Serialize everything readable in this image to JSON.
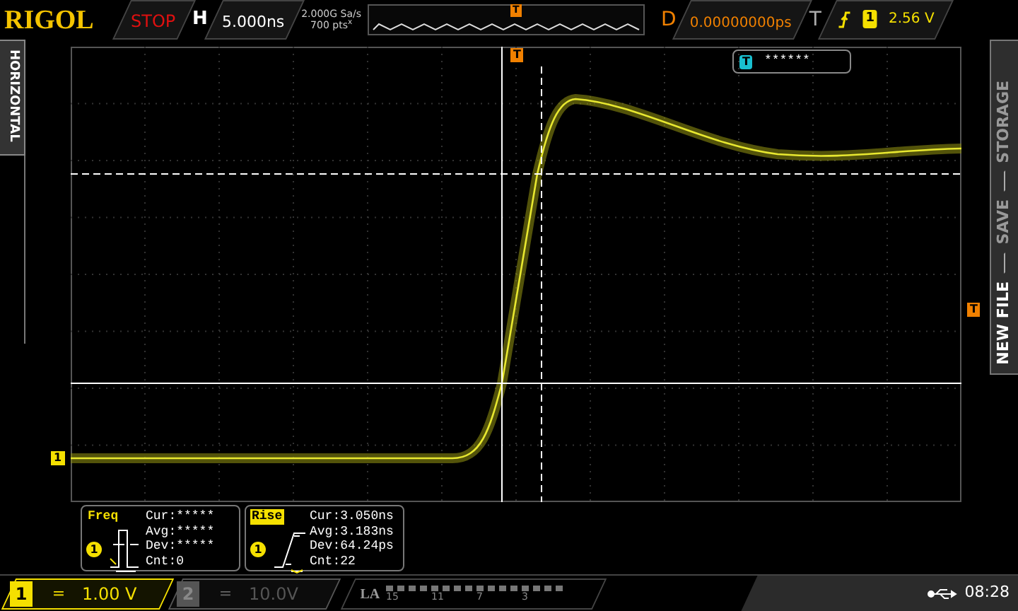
{
  "top_bar": {
    "brand": "RIGOL",
    "run_state": "STOP",
    "horizontal_label": "H",
    "timebase": "5.000ns",
    "sample_rate": "2.000G Sa/s",
    "memory_depth": "700 pts$^{x}$",
    "overview_marker": "T",
    "delay_label": "D",
    "delay": "0.00000000ps",
    "trigger_label": "T",
    "trigger_source": "1",
    "trigger_level": "2.56 V"
  },
  "left_tab": {
    "label": "HORIZONTAL"
  },
  "right_tab": {
    "items": [
      "STORAGE",
      "SAVE",
      "NEW FILE"
    ]
  },
  "display": {
    "trigger_position_marker": "T",
    "trigger_level_marker": "T",
    "channel_marker": "1",
    "readout_badge": "T",
    "readout_value": "******"
  },
  "measurements": [
    {
      "name": "Freq",
      "selected": false,
      "source": "1",
      "kind": "pulse",
      "lines": [
        "Cur:*****",
        "Avg:*****",
        "Dev:*****",
        "Cnt:0"
      ]
    },
    {
      "name": "Rise",
      "selected": true,
      "source": "1",
      "kind": "edge",
      "lines": [
        "Cur:3.050ns",
        "Avg:3.183ns",
        "Dev:64.24ps",
        "Cnt:22"
      ]
    }
  ],
  "channels": [
    {
      "label": "1",
      "coupling": "=",
      "scale": "1.00 V",
      "on": true
    },
    {
      "label": "2",
      "coupling": "=",
      "scale": "10.0V",
      "on": false
    }
  ],
  "logic": {
    "label": "LA",
    "bit_labels": [
      "15",
      "11",
      "7",
      "3"
    ]
  },
  "status": {
    "time": "08:28"
  }
}
